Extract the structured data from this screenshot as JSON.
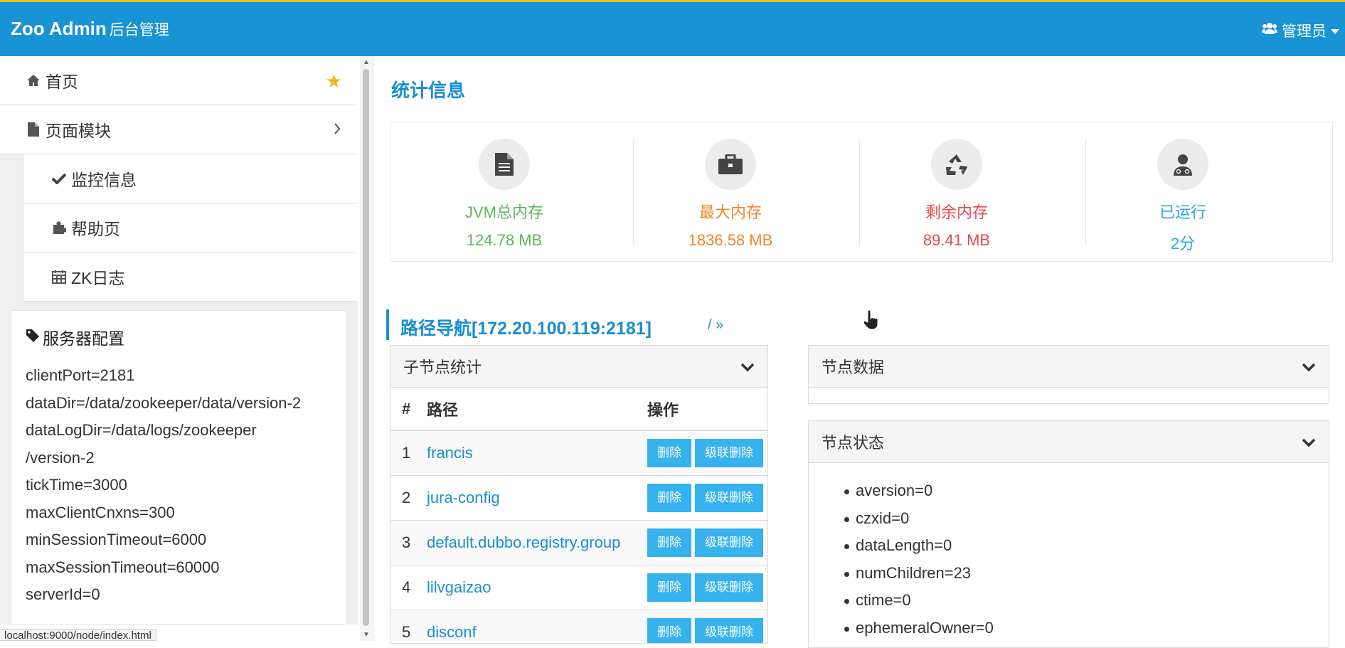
{
  "header": {
    "brand": "Zoo Admin",
    "subtitle": "后台管理",
    "user": "管理员"
  },
  "sidebar": {
    "items": [
      {
        "label": "首页",
        "icon": "home-icon"
      },
      {
        "label": "页面模块",
        "icon": "file-icon"
      }
    ],
    "subitems": [
      {
        "label": "监控信息",
        "icon": "check-icon"
      },
      {
        "label": "帮助页",
        "icon": "puzzle-icon"
      },
      {
        "label": "ZK日志",
        "icon": "calendar-icon"
      }
    ],
    "config": {
      "title": "服务器配置",
      "lines": [
        "clientPort=2181",
        "dataDir=/data/zookeeper/data/version-2",
        "dataLogDir=/data/logs/zookeeper",
        "/version-2",
        "tickTime=3000",
        "maxClientCnxns=300",
        "minSessionTimeout=6000",
        "maxSessionTimeout=60000",
        "serverId=0"
      ]
    }
  },
  "stats": {
    "title": "统计信息",
    "items": [
      {
        "label": "JVM总内存",
        "value": "124.78 MB",
        "color": "#5cb85c",
        "icon": "file-icon"
      },
      {
        "label": "最大内存",
        "value": "1836.58 MB",
        "color": "#f0862a",
        "icon": "briefcase-icon"
      },
      {
        "label": "剩余内存",
        "value": "89.41 MB",
        "color": "#e8484b",
        "icon": "recycle-icon"
      },
      {
        "label": "已运行",
        "value": "2分",
        "color": "#2aa6e6",
        "icon": "user-md-icon"
      }
    ]
  },
  "path": {
    "title": "路径导航[172.20.100.119:2181]",
    "crumb": "/ »"
  },
  "children": {
    "title": "子节点统计",
    "headers": [
      "#",
      "路径",
      "操作"
    ],
    "delete_label": "删除",
    "cascade_label": "级联删除",
    "rows": [
      {
        "num": "1",
        "path": "francis"
      },
      {
        "num": "2",
        "path": "jura-config"
      },
      {
        "num": "3",
        "path": "default.dubbo.registry.group"
      },
      {
        "num": "4",
        "path": "lilvgaizao"
      },
      {
        "num": "5",
        "path": "disconf"
      }
    ]
  },
  "node_data": {
    "title": "节点数据"
  },
  "node_status": {
    "title": "节点状态",
    "items": [
      "aversion=0",
      "czxid=0",
      "dataLength=0",
      "numChildren=23",
      "ctime=0",
      "ephemeralOwner=0"
    ]
  },
  "statusbar": {
    "url": "localhost:9000/node/index.html"
  }
}
